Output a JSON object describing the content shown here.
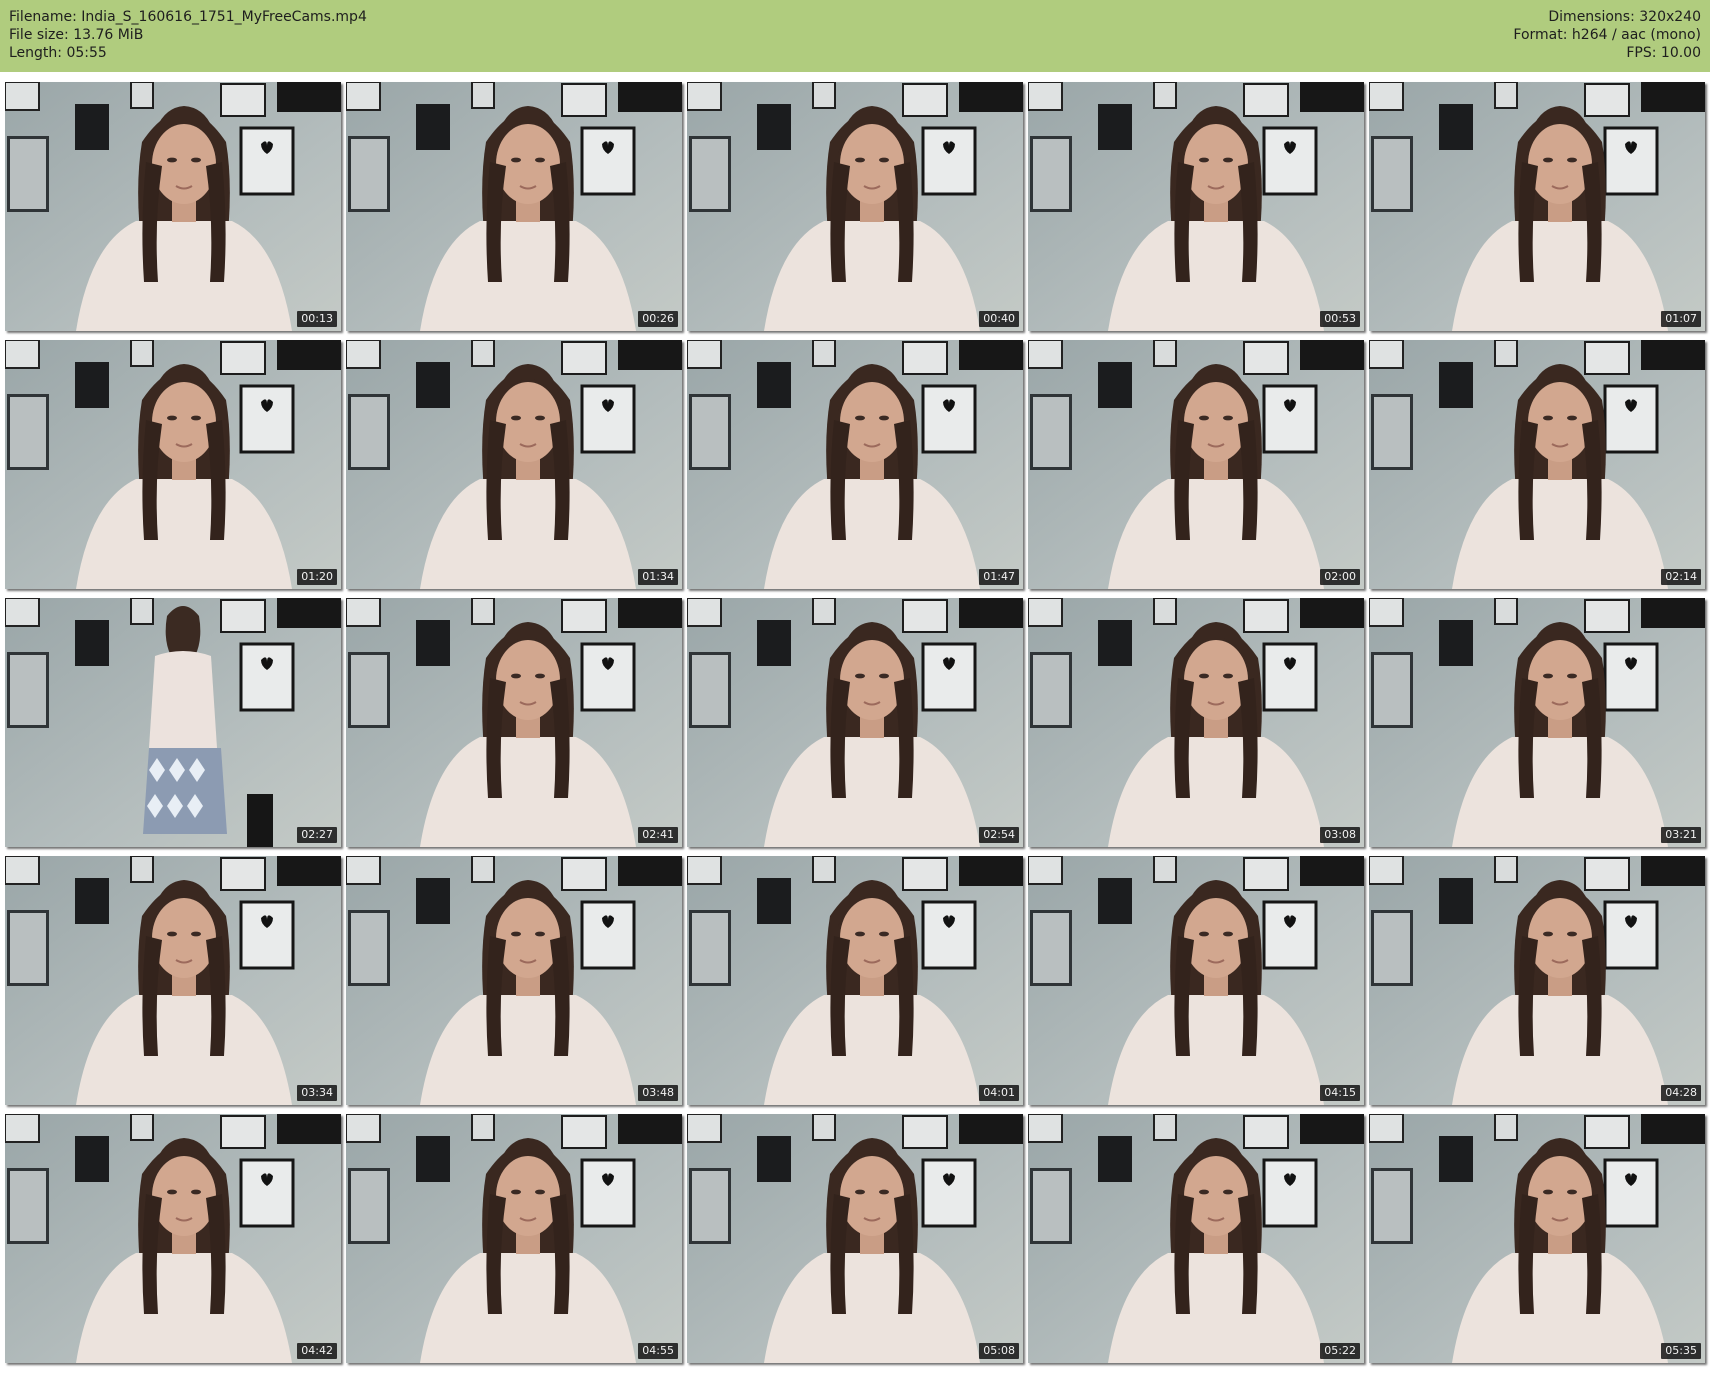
{
  "header": {
    "filename_line": "Filename: India_S_160616_1751_MyFreeCams.mp4",
    "filesize_line": "File size: 13.76 MiB",
    "length_line": "Length: 05:55",
    "dimensions_line": "Dimensions: 320x240",
    "format_line": "Format: h264 / aac (mono)",
    "fps_line": "FPS: 10.00"
  },
  "colors": {
    "header_bg": "#b0cc7e",
    "page_bg": "#ffffff",
    "timestamp_bg": "#0c0c0c"
  },
  "thumbnails": [
    {
      "time": "00:13"
    },
    {
      "time": "00:26"
    },
    {
      "time": "00:40"
    },
    {
      "time": "00:53"
    },
    {
      "time": "01:07"
    },
    {
      "time": "01:20"
    },
    {
      "time": "01:34"
    },
    {
      "time": "01:47"
    },
    {
      "time": "02:00"
    },
    {
      "time": "02:14"
    },
    {
      "time": "02:27"
    },
    {
      "time": "02:41"
    },
    {
      "time": "02:54"
    },
    {
      "time": "03:08"
    },
    {
      "time": "03:21"
    },
    {
      "time": "03:34"
    },
    {
      "time": "03:48"
    },
    {
      "time": "04:01"
    },
    {
      "time": "04:15"
    },
    {
      "time": "04:28"
    },
    {
      "time": "04:42"
    },
    {
      "time": "04:55"
    },
    {
      "time": "05:08"
    },
    {
      "time": "05:22"
    },
    {
      "time": "05:35"
    }
  ]
}
